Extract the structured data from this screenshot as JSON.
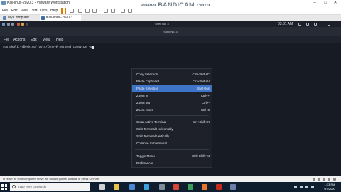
{
  "host": {
    "window_title": "Kali-linux-2020.3 - VMware Workstation",
    "menus": [
      "File",
      "Edit",
      "View",
      "VM",
      "Tabs",
      "Help"
    ],
    "tabs": [
      {
        "label": "My Computer"
      },
      {
        "label": "Kali-linux-2020.3"
      }
    ],
    "status_text": "To return to your computer, move the mouse pointer outside or press Ctrl+Alt."
  },
  "watermark": "www.BANDICAM.com",
  "kali": {
    "panel_title": "Shell No. 3",
    "clock": "03:31 AM"
  },
  "terminal": {
    "title": "Shell No. 3",
    "menus": [
      "File",
      "Actions",
      "Edit",
      "View",
      "Help"
    ],
    "prompt": "root@kali:~/Desktop/tools/Convy# python3 convy.py -u"
  },
  "context_menu": {
    "items": [
      {
        "label": "Copy Selection",
        "shortcut": "Ctrl+Shift+C"
      },
      {
        "label": "Paste Clipboard",
        "shortcut": "Ctrl+Shift+V"
      },
      {
        "label": "Paste Selection",
        "shortcut": "Shift+Ins"
      },
      {
        "label": "Zoom in",
        "shortcut": "Ctrl++"
      },
      {
        "label": "Zoom out",
        "shortcut": "Ctrl+-"
      },
      {
        "label": "Zoom reset",
        "shortcut": "Ctrl+0"
      },
      {
        "label": "Clear Active Terminal",
        "shortcut": "Ctrl+Shift+X"
      },
      {
        "label": "Split Terminal Horizontally",
        "shortcut": ""
      },
      {
        "label": "Split Terminal Vertically",
        "shortcut": ""
      },
      {
        "label": "Collapse Subterminal",
        "shortcut": ""
      },
      {
        "label": "Toggle Menu",
        "shortcut": "Ctrl+Shift+M"
      },
      {
        "label": "Preferences...",
        "shortcut": ""
      }
    ],
    "highlighted": "Paste Selection"
  },
  "taskbar": {
    "search_placeholder": "Type here to search",
    "time": "1:33 PM",
    "date": "9/7/2020"
  },
  "colors": {
    "highlight": "#3f75c8",
    "menu_bg": "#1e2129",
    "terminal_bg": "#171b24",
    "pause_orange": "#e07b00"
  }
}
